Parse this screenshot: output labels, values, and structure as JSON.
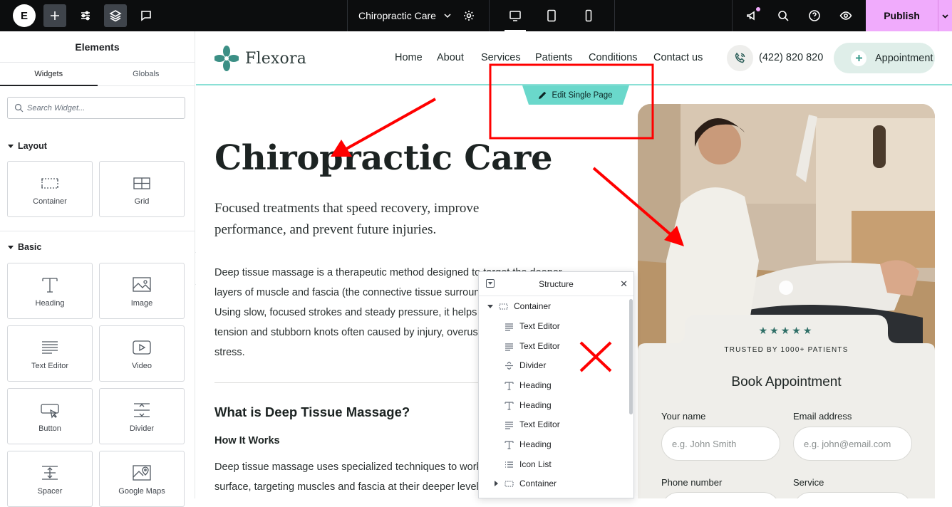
{
  "topbar": {
    "logo_letter": "E",
    "page_title": "Chiropractic Care",
    "publish_label": "Publish"
  },
  "panel": {
    "title": "Elements",
    "tabs": [
      {
        "label": "Widgets"
      },
      {
        "label": "Globals"
      }
    ],
    "search_placeholder": "Search Widget...",
    "categories": {
      "layout": "Layout",
      "basic": "Basic"
    },
    "widgets": [
      {
        "label": "Container",
        "icon": "container-icon"
      },
      {
        "label": "Grid",
        "icon": "grid-icon"
      },
      {
        "label": "Heading",
        "icon": "heading-icon"
      },
      {
        "label": "Image",
        "icon": "image-icon"
      },
      {
        "label": "Text Editor",
        "icon": "text-editor-icon"
      },
      {
        "label": "Video",
        "icon": "video-icon"
      },
      {
        "label": "Button",
        "icon": "button-icon"
      },
      {
        "label": "Divider",
        "icon": "divider-icon"
      },
      {
        "label": "Spacer",
        "icon": "spacer-icon"
      },
      {
        "label": "Google Maps",
        "icon": "google-maps-icon"
      }
    ]
  },
  "site": {
    "brand": "Flexora",
    "nav": [
      "Home",
      "About",
      "Services",
      "Patients",
      "Conditions",
      "Contact us"
    ],
    "phone": "(422) 820 820",
    "cta": "Appointment",
    "edit_tab": "Edit Single Page",
    "hero_title": "Chiropractic Care",
    "hero_sub": "Focused treatments that speed recovery, improve performance, and prevent future injuries.",
    "para1": "Deep tissue massage is a therapeutic method designed to target the deeper layers of muscle and fascia (the connective tissue surrounding muscles). Using slow, focused strokes and steady pressure, it helps release chronic tension and stubborn knots often caused by injury, overuse, or ongoing stress.",
    "h2": "What is Deep Tissue Massage?",
    "h3": "How It Works",
    "para2": "Deep tissue massage uses specialized techniques to work beneath the surface, targeting muscles and fascia at their deeper levels.",
    "booking": {
      "stars": "★★★★★",
      "trusted": "TRUSTED BY 1000+ PATIENTS",
      "title": "Book Appointment",
      "name_label": "Your name",
      "name_placeholder": "e.g. John Smith",
      "email_label": "Email address",
      "email_placeholder": "e.g. john@email.com",
      "phone_label": "Phone number",
      "service_label": "Service"
    }
  },
  "structure": {
    "title": "Structure",
    "items": [
      {
        "label": "Container",
        "icon": "container-icon"
      },
      {
        "label": "Text Editor",
        "icon": "text-editor-icon"
      },
      {
        "label": "Text Editor",
        "icon": "text-editor-icon"
      },
      {
        "label": "Divider",
        "icon": "divider-icon"
      },
      {
        "label": "Heading",
        "icon": "heading-icon"
      },
      {
        "label": "Heading",
        "icon": "heading-icon"
      },
      {
        "label": "Text Editor",
        "icon": "text-editor-icon"
      },
      {
        "label": "Heading",
        "icon": "heading-icon"
      },
      {
        "label": "Icon List",
        "icon": "icon-list-icon"
      },
      {
        "label": "Container",
        "icon": "container-icon"
      }
    ]
  },
  "colors": {
    "accent_teal": "#6ad8cb",
    "annotation_red": "#ff0000",
    "publish_pink": "#f0abfc",
    "brand_green": "#3a9b8c"
  }
}
